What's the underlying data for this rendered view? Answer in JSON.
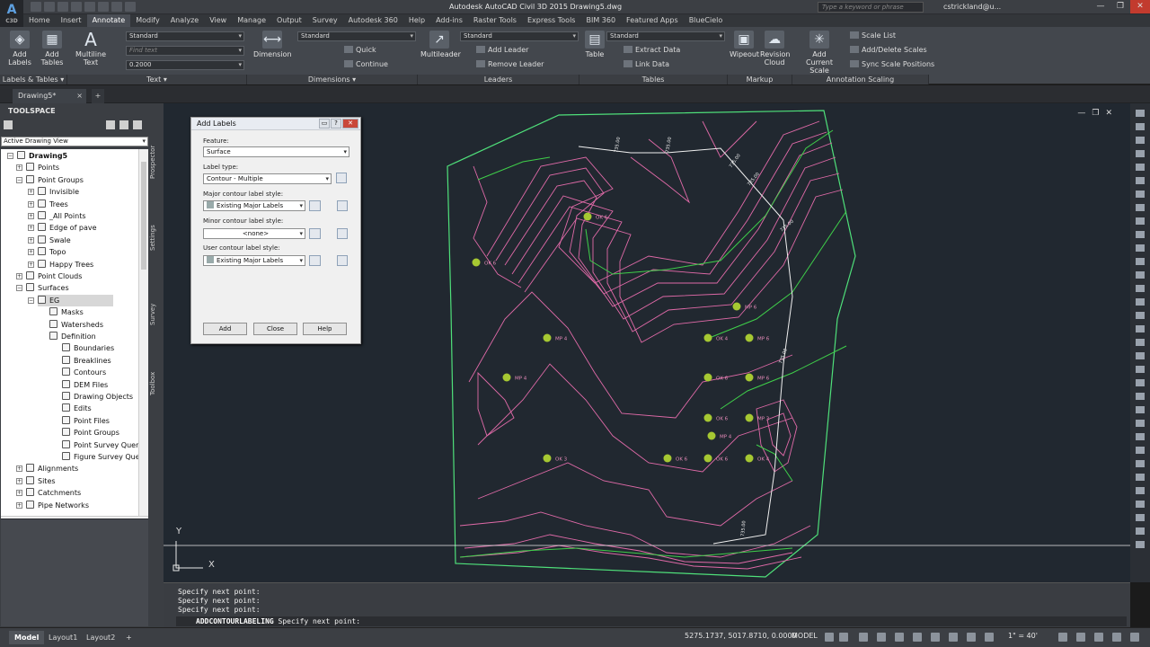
{
  "app": {
    "logo_letter": "A",
    "logo_sub": "C3D",
    "title": "Autodesk AutoCAD Civil 3D 2015    Drawing5.dwg",
    "search_placeholder": "Type a keyword or phrase",
    "user": "cstrickland@u...",
    "window_controls": [
      "—",
      "❐",
      "✕"
    ]
  },
  "menu_tabs": [
    "Home",
    "Insert",
    "Annotate",
    "Modify",
    "Analyze",
    "View",
    "Manage",
    "Output",
    "Survey",
    "Autodesk 360",
    "Help",
    "Add-ins",
    "Raster Tools",
    "Express Tools",
    "BIM 360",
    "Featured Apps",
    "BlueCielo"
  ],
  "ribbon": {
    "add_labels": "Add Labels",
    "add_tables": "Add Tables",
    "multiline_text": "Multiline Text",
    "text_style": "Standard",
    "find_text": "Find text",
    "text_height": "0.2000",
    "dimension": "Dimension",
    "dim_style": "Standard",
    "quick": "Quick",
    "continue": "Continue",
    "multileader": "Multileader",
    "leader_style": "Standard",
    "add_leader": "Add Leader",
    "remove_leader": "Remove Leader",
    "table": "Table",
    "table_style": "Standard",
    "extract_data": "Extract Data",
    "link_data": "Link Data",
    "wipeout": "Wipeout",
    "revision_cloud": "Revision Cloud",
    "add_current_scale": "Add Current Scale",
    "scale_list": "Scale List",
    "add_delete_scales": "Add/Delete Scales",
    "sync_scale_positions": "Sync Scale Positions",
    "panels": [
      "Labels & Tables ▾",
      "Text ▾",
      "Dimensions ▾",
      "Leaders",
      "Tables",
      "Markup",
      "Annotation Scaling"
    ]
  },
  "file_tab": {
    "name": "Drawing5*",
    "close": "×",
    "new": "+"
  },
  "toolspace": {
    "title": "TOOLSPACE",
    "view": "Active Drawing View",
    "side_tabs": [
      "Prospector",
      "Settings",
      "Survey",
      "Toolbox"
    ],
    "tree": [
      {
        "label": "Drawing5",
        "level": 0,
        "bold": true
      },
      {
        "label": "Points",
        "level": 1
      },
      {
        "label": "Point Groups",
        "level": 1
      },
      {
        "label": "Invisible",
        "level": 2
      },
      {
        "label": "Trees",
        "level": 2
      },
      {
        "label": "_All Points",
        "level": 2
      },
      {
        "label": "Edge of pave",
        "level": 2
      },
      {
        "label": "Swale",
        "level": 2
      },
      {
        "label": "Topo",
        "level": 2
      },
      {
        "label": "Happy Trees",
        "level": 2
      },
      {
        "label": "Point Clouds",
        "level": 1
      },
      {
        "label": "Surfaces",
        "level": 1
      },
      {
        "label": "EG",
        "level": 2,
        "selected": true
      },
      {
        "label": "Masks",
        "level": 3
      },
      {
        "label": "Watersheds",
        "level": 3
      },
      {
        "label": "Definition",
        "level": 3
      },
      {
        "label": "Boundaries",
        "level": 4
      },
      {
        "label": "Breaklines",
        "level": 4
      },
      {
        "label": "Contours",
        "level": 4
      },
      {
        "label": "DEM Files",
        "level": 4
      },
      {
        "label": "Drawing Objects",
        "level": 4
      },
      {
        "label": "Edits",
        "level": 4
      },
      {
        "label": "Point Files",
        "level": 4
      },
      {
        "label": "Point Groups",
        "level": 4
      },
      {
        "label": "Point Survey Quer...",
        "level": 4
      },
      {
        "label": "Figure Survey Que...",
        "level": 4
      },
      {
        "label": "Alignments",
        "level": 1
      },
      {
        "label": "Sites",
        "level": 1
      },
      {
        "label": "Catchments",
        "level": 1
      },
      {
        "label": "Pipe Networks",
        "level": 1
      }
    ]
  },
  "dialog": {
    "title": "Add Labels",
    "title_buttons": [
      "▭",
      "?",
      "✕"
    ],
    "feature_label": "Feature:",
    "feature": "Surface",
    "label_type_label": "Label type:",
    "label_type": "Contour - Multiple",
    "major_label": "Major contour label style:",
    "major": "Existing Major Labels",
    "minor_label": "Minor contour label style:",
    "minor": "<none>",
    "user_label": "User contour label style:",
    "user": "Existing Major Labels",
    "buttons": [
      "Add",
      "Close",
      "Help"
    ]
  },
  "canvas": {
    "viewport_controls": [
      "—",
      "❐",
      "✕"
    ],
    "ucs_x": "X",
    "ucs_y": "Y",
    "point_labels": [
      {
        "id": "pt1",
        "text": "OK 6"
      },
      {
        "id": "pt2",
        "text": "OK 6"
      },
      {
        "id": "pt3",
        "text": "MP 4"
      },
      {
        "id": "pt4",
        "text": "MP 6"
      },
      {
        "id": "pt5",
        "text": "OK 4"
      },
      {
        "id": "pt6",
        "text": "MP 6"
      },
      {
        "id": "pt7",
        "text": "MP 4"
      },
      {
        "id": "pt8",
        "text": "OK 6"
      },
      {
        "id": "pt9",
        "text": "MP 6"
      },
      {
        "id": "pt10",
        "text": "OK 6"
      },
      {
        "id": "pt11",
        "text": "MP 3"
      },
      {
        "id": "pt12",
        "text": "MP 4"
      },
      {
        "id": "pt13",
        "text": "OK 3"
      },
      {
        "id": "pt14",
        "text": "OK 6"
      },
      {
        "id": "pt15",
        "text": "OK 6"
      },
      {
        "id": "pt16",
        "text": "OK 4"
      }
    ],
    "contour_labels": [
      "735.00",
      "735.00",
      "735.00",
      "735.00",
      "735.00",
      "735.00",
      "735.00"
    ]
  },
  "command": {
    "history": [
      "Specify next point:",
      "Specify next point:",
      "Specify next point:"
    ],
    "input_command": "ADDCONTOURLABELING",
    "input_prompt": " Specify next point:"
  },
  "status": {
    "tabs": [
      "Model",
      "Layout1",
      "Layout2",
      "+"
    ],
    "coords": "5275.1737, 5017.8710, 0.0000",
    "space": "MODEL",
    "scale": "1\" = 40'"
  },
  "colors": {
    "canvas_bg": "#212830",
    "minor_contour": "#e06aa8",
    "major_contour": "#3fcf4a",
    "boundary": "#4fe07a",
    "point": "#a6c832",
    "alignment": "#f0f0f0"
  }
}
